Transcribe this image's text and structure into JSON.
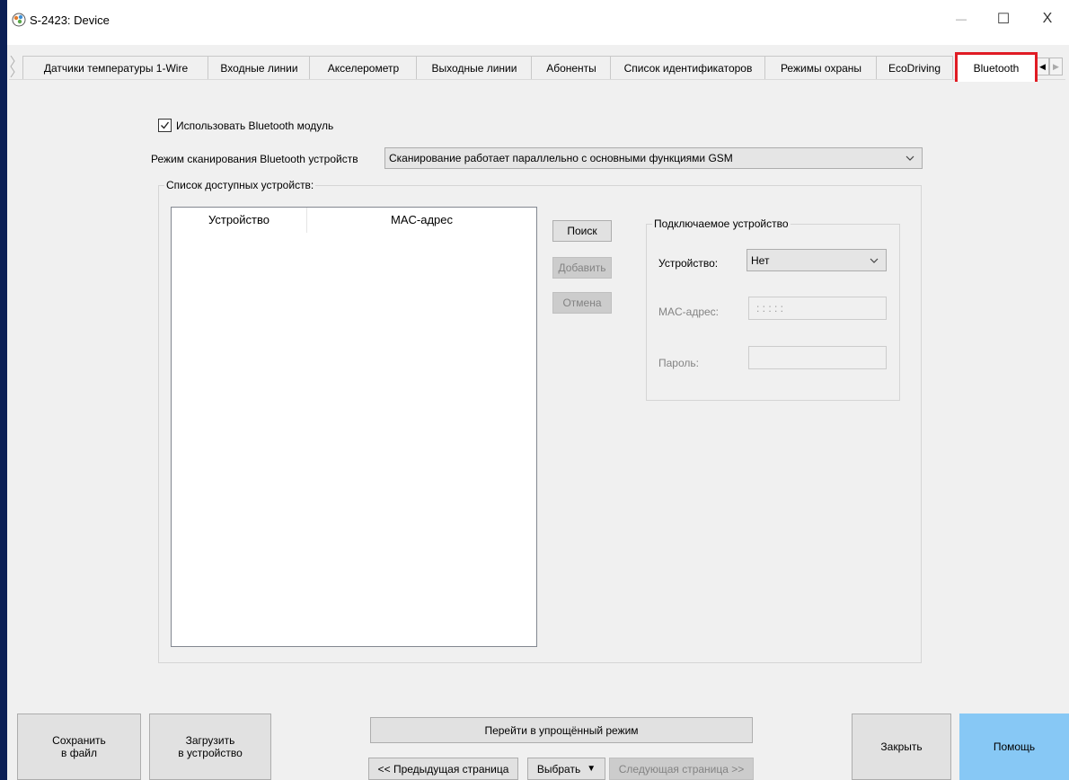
{
  "window": {
    "title": "S-2423: Device"
  },
  "window_controls": {
    "minimize": "—",
    "maximize": "☐",
    "close": "X"
  },
  "tabs": [
    {
      "label": "Датчики температуры 1-Wire"
    },
    {
      "label": "Входные линии"
    },
    {
      "label": "Акселерометр"
    },
    {
      "label": "Выходные линии"
    },
    {
      "label": "Абоненты"
    },
    {
      "label": "Список идентификаторов"
    },
    {
      "label": "Режимы охраны"
    },
    {
      "label": "EcoDriving"
    },
    {
      "label": "Bluetooth",
      "active": true
    }
  ],
  "bluetooth": {
    "use_module_label": "Использовать Bluetooth модуль",
    "use_module_checked": true,
    "scan_mode_label": "Режим сканирования Bluetooth устройств",
    "scan_mode_value": "Сканирование работает параллельно с основными функциями GSM",
    "available_devices_title": "Список доступных устройств:",
    "columns": {
      "device": "Устройство",
      "mac": "MAC-адрес"
    },
    "buttons": {
      "search": "Поиск",
      "add": "Добавить",
      "cancel": "Отмена"
    },
    "connected": {
      "title": "Подключаемое устройство",
      "device_label": "Устройство:",
      "device_value": "Нет",
      "mac_label": "MAC-адрес:",
      "mac_value": ": : : : :",
      "password_label": "Пароль:",
      "password_value": ""
    }
  },
  "footer": {
    "save_line1": "Сохранить",
    "save_line2": "в файл",
    "load_line1": "Загрузить",
    "load_line2": "в устройство",
    "simple_mode": "Перейти в упрощённый режим",
    "prev_page": "<< Предыдущая страница",
    "select": "Выбрать",
    "next_page": "Следующая страница >>",
    "close": "Закрыть",
    "help": "Помощь"
  },
  "colors": {
    "accent_highlight": "#e01c24",
    "help_button": "#87c8f5",
    "desktop": "#0b1f55"
  }
}
